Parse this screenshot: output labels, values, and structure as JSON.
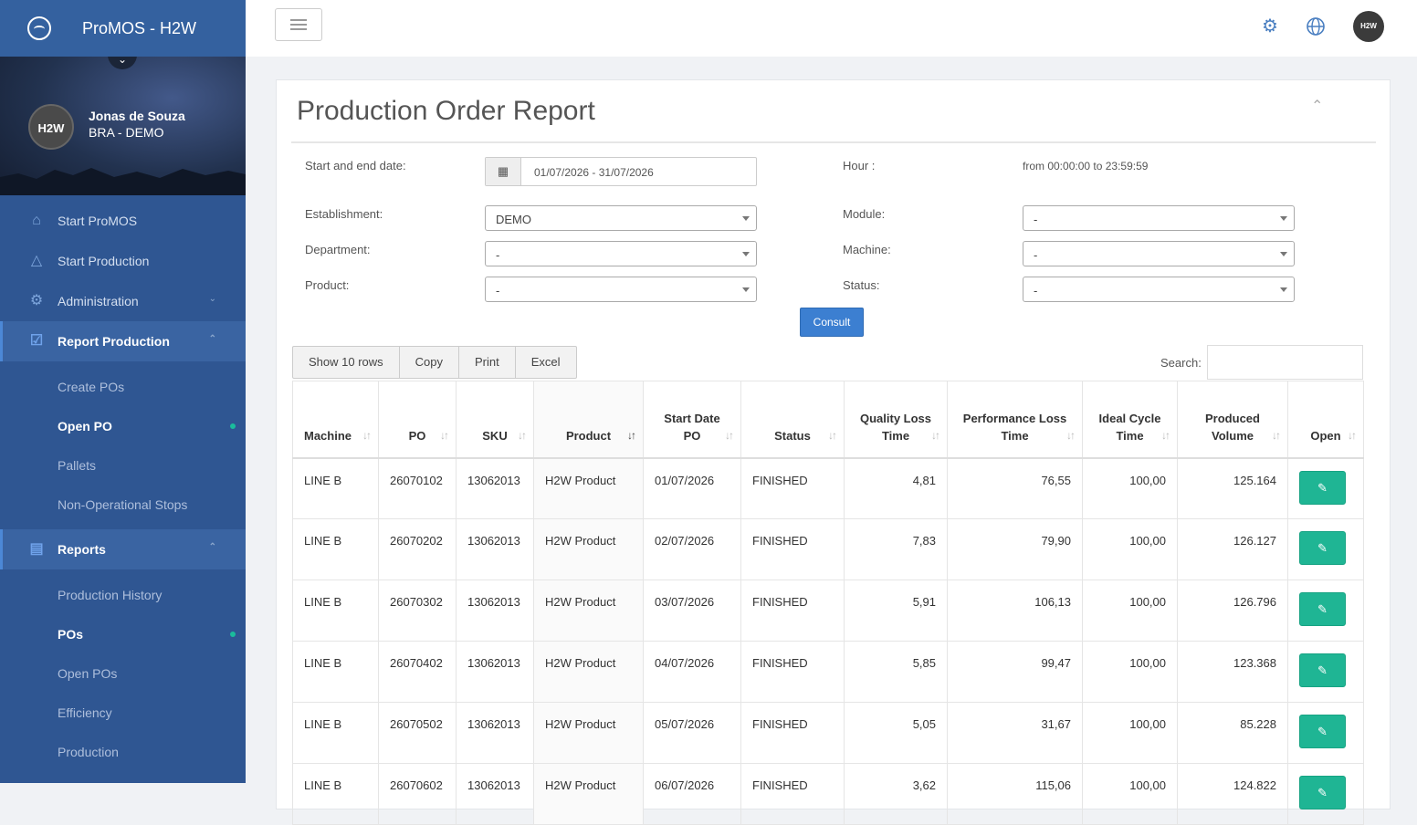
{
  "app": {
    "title": "ProMOS - H2W"
  },
  "user": {
    "avatar_text": "H2W",
    "name": "Jonas de Souza",
    "org": "BRA - DEMO"
  },
  "sidebar": {
    "items": [
      {
        "label": "Start ProMOS",
        "icon": "home-icon"
      },
      {
        "label": "Start Production",
        "icon": "flask-icon"
      },
      {
        "label": "Administration",
        "icon": "cogs-icon"
      },
      {
        "label": "Report Production",
        "icon": "checkbox-icon"
      }
    ],
    "report_production_sub": [
      {
        "label": "Create POs",
        "active": false
      },
      {
        "label": "Open PO",
        "active": true
      },
      {
        "label": "Pallets",
        "active": false
      },
      {
        "label": "Non-Operational Stops",
        "active": false
      }
    ],
    "reports": {
      "label": "Reports",
      "icon": "bar-chart-icon"
    },
    "reports_sub": [
      {
        "label": "Production History",
        "active": false
      },
      {
        "label": "POs",
        "active": true
      },
      {
        "label": "Open POs",
        "active": false
      },
      {
        "label": "Efficiency",
        "active": false
      },
      {
        "label": "Production",
        "active": false
      }
    ]
  },
  "topbar": {
    "avatar_text": "H2W"
  },
  "page": {
    "title": "Production Order Report"
  },
  "filters": {
    "date_label": "Start and end date:",
    "date_value": "01/07/2026 - 31/07/2026",
    "hour_label": "Hour :",
    "hour_value": "from 00:00:00 to 23:59:59",
    "establishment_label": "Establishment:",
    "establishment_value": "DEMO",
    "module_label": "Module:",
    "module_value": "-",
    "department_label": "Department:",
    "department_value": "-",
    "machine_label": "Machine:",
    "machine_value": "-",
    "product_label": "Product:",
    "product_value": "-",
    "status_label": "Status:",
    "status_value": "-",
    "consult_label": "Consult"
  },
  "toolbar": {
    "show_rows": "Show 10 rows",
    "copy": "Copy",
    "print": "Print",
    "excel": "Excel",
    "search_label": "Search:"
  },
  "table": {
    "headers": [
      "Machine",
      "PO",
      "SKU",
      "Product",
      "Start Date PO",
      "Status",
      "Quality Loss Time",
      "Performance Loss Time",
      "Ideal Cycle Time",
      "Produced Volume",
      "Open"
    ],
    "rows": [
      [
        "LINE B",
        "26070102",
        "13062013",
        "H2W Product",
        "01/07/2026",
        "FINISHED",
        "4,81",
        "76,55",
        "100,00",
        "125.164"
      ],
      [
        "LINE B",
        "26070202",
        "13062013",
        "H2W Product",
        "02/07/2026",
        "FINISHED",
        "7,83",
        "79,90",
        "100,00",
        "126.127"
      ],
      [
        "LINE B",
        "26070302",
        "13062013",
        "H2W Product",
        "03/07/2026",
        "FINISHED",
        "5,91",
        "106,13",
        "100,00",
        "126.796"
      ],
      [
        "LINE B",
        "26070402",
        "13062013",
        "H2W Product",
        "04/07/2026",
        "FINISHED",
        "5,85",
        "99,47",
        "100,00",
        "123.368"
      ],
      [
        "LINE B",
        "26070502",
        "13062013",
        "H2W Product",
        "05/07/2026",
        "FINISHED",
        "5,05",
        "31,67",
        "100,00",
        "85.228"
      ],
      [
        "LINE B",
        "26070602",
        "13062013",
        "H2W Product",
        "06/07/2026",
        "FINISHED",
        "3,62",
        "115,06",
        "100,00",
        "124.822"
      ]
    ]
  },
  "colors": {
    "sidebar": "#2f5692",
    "accent": "#3c7fd1",
    "open_button": "#1fb594"
  }
}
